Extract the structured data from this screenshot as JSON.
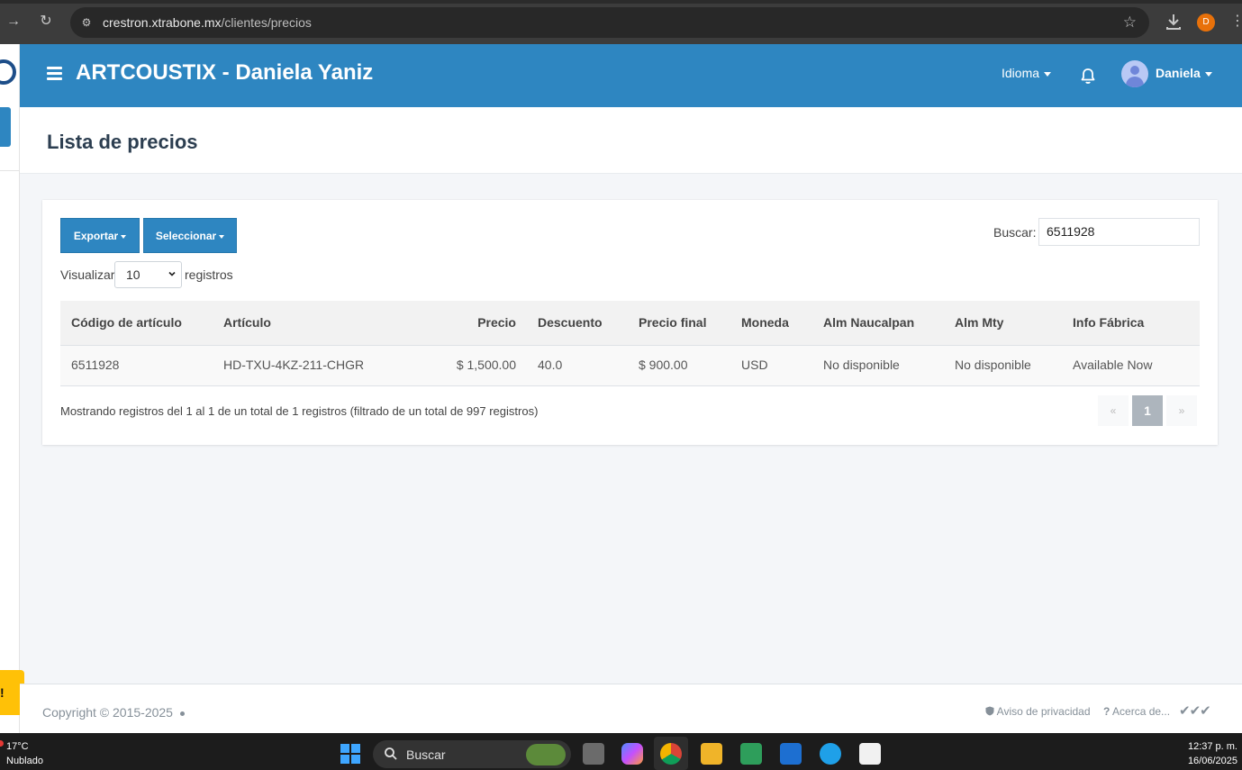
{
  "browser": {
    "url_host": "crestron.xtrabone.mx",
    "url_path": "/clientes/precios",
    "profile_initial": "D"
  },
  "header": {
    "title": "ARTCOUSTIX - Daniela Yaniz",
    "language_label": "Idioma",
    "user_name": "Daniela",
    "color": "#2e86c1"
  },
  "page": {
    "title": "Lista de precios"
  },
  "toolbar": {
    "export_label": "Exportar",
    "select_label": "Seleccionar",
    "show_label": "Visualizar",
    "page_length": "10",
    "records_label": "registros",
    "search_label": "Buscar:",
    "search_value": "6511928"
  },
  "table": {
    "columns": [
      "Código de artículo",
      "Artículo",
      "Precio",
      "Descuento",
      "Precio final",
      "Moneda",
      "Alm Naucalpan",
      "Alm Mty",
      "Info Fábrica"
    ],
    "rows": [
      [
        "6511928",
        "HD-TXU-4KZ-211-CHGR",
        "$ 1,500.00",
        "40.0",
        "$ 900.00",
        "USD",
        "No disponible",
        "No disponible",
        "Available Now"
      ]
    ]
  },
  "pagination": {
    "info": "Mostrando registros del 1 al 1 de un total de 1 registros (filtrado de un total de 997 registros)",
    "prev": "«",
    "current": "1",
    "next": "»"
  },
  "footer": {
    "copyright": "Copyright © 2015-2025",
    "privacy": "Aviso de privacidad",
    "about": "Acerca de..."
  },
  "taskbar": {
    "weather_temp": "17°C",
    "weather_text": "Nublado",
    "search_label": "Buscar",
    "time": "12:37 p. m.",
    "date": "16/06/2025"
  }
}
